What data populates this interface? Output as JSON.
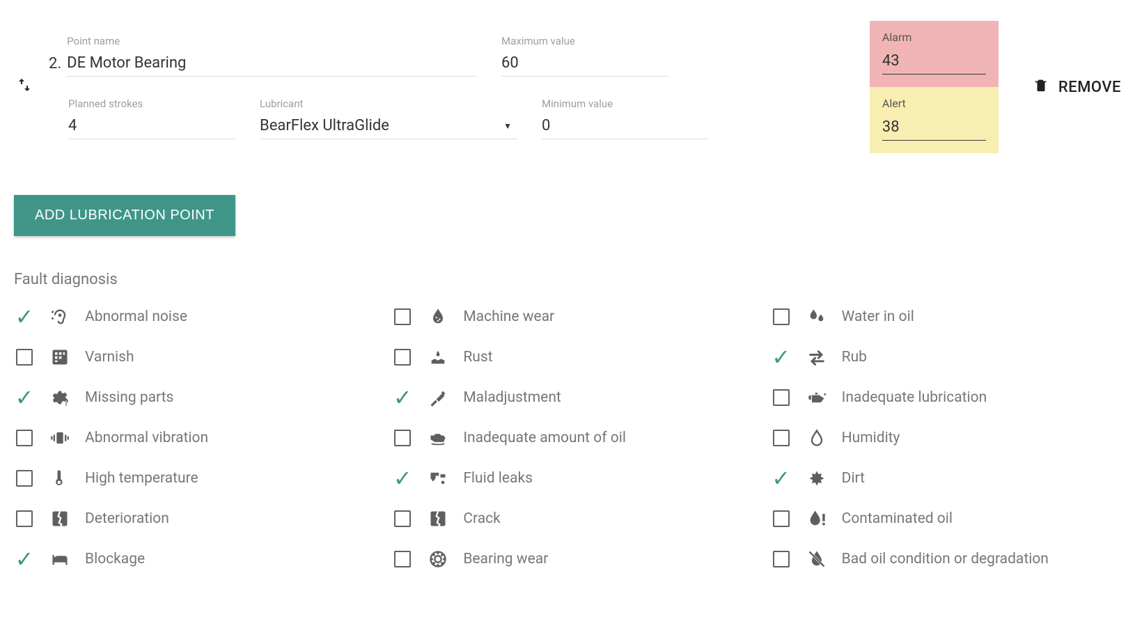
{
  "point": {
    "index": "2.",
    "labels": {
      "name": "Point name",
      "strokes": "Planned strokes",
      "lubricant": "Lubricant",
      "max": "Maximum value",
      "min": "Minimum value",
      "alarm": "Alarm",
      "alert": "Alert"
    },
    "values": {
      "name": "DE Motor Bearing",
      "strokes": "4",
      "lubricant": "BearFlex UltraGlide",
      "max": "60",
      "min": "0",
      "alarm": "43",
      "alert": "38"
    },
    "remove": "REMOVE"
  },
  "add_button": "ADD LUBRICATION POINT",
  "fault_section_title": "Fault diagnosis",
  "faults": [
    {
      "label": "Abnormal noise",
      "checked": true,
      "icon": "ear"
    },
    {
      "label": "Machine wear",
      "checked": false,
      "icon": "water-drop-pattern"
    },
    {
      "label": "Water in oil",
      "checked": false,
      "icon": "two-drops"
    },
    {
      "label": "Varnish",
      "checked": false,
      "icon": "grid-square"
    },
    {
      "label": "Rust",
      "checked": false,
      "icon": "rust"
    },
    {
      "label": "Rub",
      "checked": true,
      "icon": "arrows-lr"
    },
    {
      "label": "Missing parts",
      "checked": true,
      "icon": "gear-question"
    },
    {
      "label": "Maladjustment",
      "checked": true,
      "icon": "screwdriver"
    },
    {
      "label": "Inadequate lubrication",
      "checked": false,
      "icon": "oil-can"
    },
    {
      "label": "Abnormal vibration",
      "checked": false,
      "icon": "vibration"
    },
    {
      "label": "Inadequate amount of oil",
      "checked": false,
      "icon": "engine-oil"
    },
    {
      "label": "Humidity",
      "checked": false,
      "icon": "drop-outline"
    },
    {
      "label": "High temperature",
      "checked": false,
      "icon": "thermometer"
    },
    {
      "label": "Fluid leaks",
      "checked": true,
      "icon": "leak"
    },
    {
      "label": "Dirt",
      "checked": true,
      "icon": "splat"
    },
    {
      "label": "Deterioration",
      "checked": false,
      "icon": "crack-square"
    },
    {
      "label": "Crack",
      "checked": false,
      "icon": "crack-square"
    },
    {
      "label": "Contaminated oil",
      "checked": false,
      "icon": "drop-warn"
    },
    {
      "label": "Blockage",
      "checked": true,
      "icon": "bed"
    },
    {
      "label": "Bearing wear",
      "checked": false,
      "icon": "bearing"
    },
    {
      "label": "Bad oil condition or degradation",
      "checked": false,
      "icon": "drop-slash"
    }
  ]
}
